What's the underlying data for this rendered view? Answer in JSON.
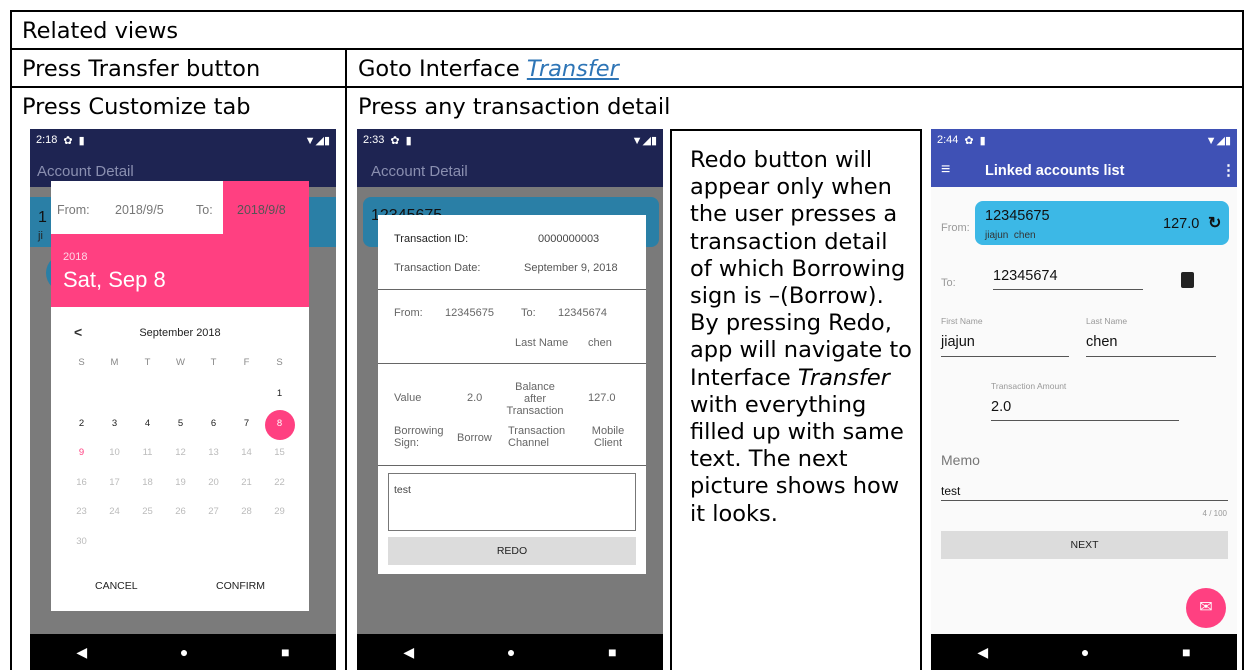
{
  "table": {
    "row1": "Related views",
    "row2_left": "Press Transfer button",
    "row2_right_prefix": "Goto Interface ",
    "row2_right_link": "Transfer",
    "row3_left": "Press Customize tab",
    "row3_right": "Press any transaction detail"
  },
  "phone1": {
    "time": "2:18",
    "appbar_title": "Account Detail",
    "from_label": "From:",
    "from_date": "2018/9/5",
    "to_label": "To:",
    "to_date": "2018/9/8",
    "year": "2018",
    "big_date": "Sat, Sep 8",
    "month_title": "September 2018",
    "weekdays": [
      "S",
      "M",
      "T",
      "W",
      "T",
      "F",
      "S"
    ],
    "weeks": [
      [
        "",
        "",
        "",
        "",
        "",
        "",
        "1"
      ],
      [
        "2",
        "3",
        "4",
        "5",
        "6",
        "7",
        "8"
      ],
      [
        "9",
        "10",
        "11",
        "12",
        "13",
        "14",
        "15"
      ],
      [
        "16",
        "17",
        "18",
        "19",
        "20",
        "21",
        "22"
      ],
      [
        "23",
        "24",
        "25",
        "26",
        "27",
        "28",
        "29"
      ],
      [
        "30",
        "",
        "",
        "",
        "",
        "",
        ""
      ]
    ],
    "selected_day": "8",
    "today_day": "9",
    "cancel": "CANCEL",
    "confirm": "CONFIRM",
    "prev_icon": "<",
    "bg_text_1": "1",
    "bg_text_2": "ji"
  },
  "phone2": {
    "time": "2:33",
    "appbar_title": "Account Detail",
    "bg_account": "12345675",
    "txn_id_label": "Transaction ID:",
    "txn_id": "0000000003",
    "txn_date_label": "Transaction Date:",
    "txn_date": "September 9, 2018",
    "from_label": "From:",
    "from_value": "12345675",
    "to_label": "To:",
    "to_value": "12345674",
    "last_name_label": "Last Name",
    "last_name": "chen",
    "value_label": "Value",
    "value": "2.0",
    "balance_label_1": "Balance after",
    "balance_label_2": "Transaction",
    "balance": "127.0",
    "borrowing_label_1": "Borrowing",
    "borrowing_label_2": "Sign:",
    "borrowing": "Borrow",
    "channel_label_1": "Transaction",
    "channel_label_2": "Channel",
    "channel_1": "Mobile",
    "channel_2": "Client",
    "memo": "test",
    "redo": "REDO"
  },
  "note": {
    "line_1": "Redo button will",
    "line_2": "appear only when",
    "line_3": "the user presses a",
    "line_4": "transaction detail",
    "line_5": "of which Borrowing",
    "line_6": "sign is –(Borrow).",
    "line_7": "By pressing Redo,",
    "line_8": "app will navigate to",
    "line_9_prefix": "Interface ",
    "line_9_italic": "Transfer",
    "line_10": "with everything",
    "line_11": "filled up with same",
    "line_12": "text. The next",
    "line_13": "picture shows how",
    "line_14": "it looks."
  },
  "phone3": {
    "time": "2:44",
    "appbar_title": "Linked accounts list",
    "from_label": "From:",
    "from_account": "12345675",
    "from_name": "jiajun  chen",
    "from_balance": "127.0",
    "to_label": "To:",
    "to_account": "12345674",
    "first_name_label": "First Name",
    "first_name": "jiajun",
    "last_name_label": "Last Name",
    "last_name": "chen",
    "amount_label": "Transaction Amount",
    "amount": "2.0",
    "memo_label": "Memo",
    "memo": "test",
    "memo_counter": "4 / 100",
    "next": "NEXT"
  },
  "colors": {
    "appbar_blue": "#3f51b5",
    "dim_appbar": "#1e2452",
    "pink": "#ff4081",
    "cyan": "#3cb8e6",
    "link_blue": "#2e75b6"
  },
  "icons": {
    "settings": "gear-icon",
    "sim": "sim-icon",
    "wifi": "wifi-icon",
    "battery": "battery-icon",
    "back": "back-triangle-icon",
    "home": "home-circle-icon",
    "recents": "recents-square-icon",
    "menu": "menu-icon",
    "overflow": "more-vert-icon",
    "refresh": "refresh-icon",
    "contacts": "contacts-icon",
    "email": "email-icon"
  }
}
